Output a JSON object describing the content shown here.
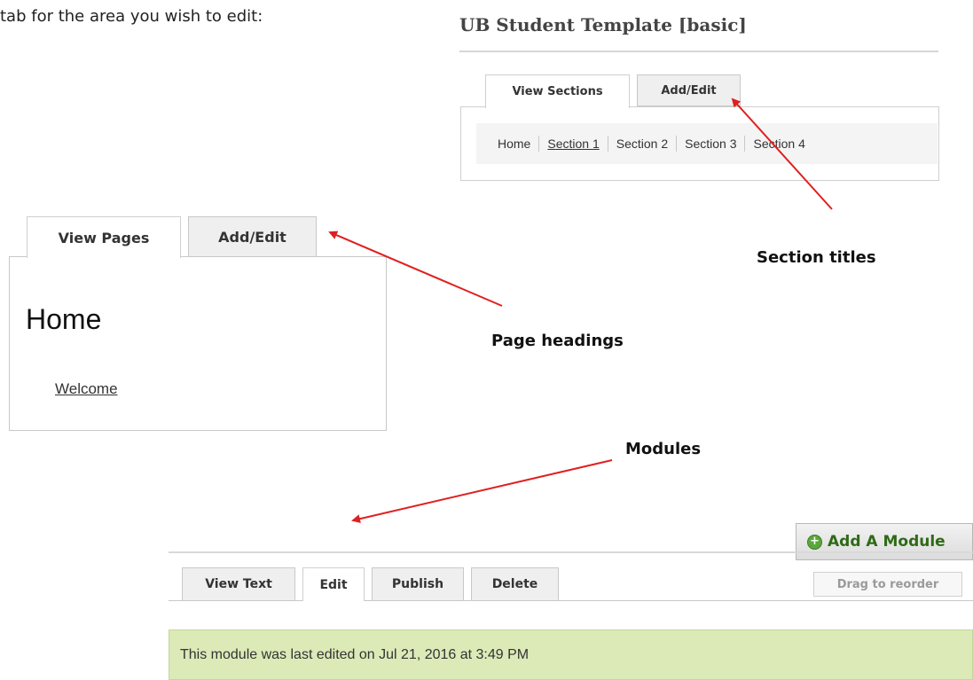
{
  "intro_text": "tab for the area you wish to edit:",
  "template": {
    "title": "UB Student Template [basic]",
    "tabs": [
      "View Sections",
      "Add/Edit"
    ],
    "sections": [
      "Home",
      "Section 1",
      "Section 2",
      "Section 3",
      "Section 4"
    ]
  },
  "pages": {
    "tabs": [
      "View Pages",
      "Add/Edit"
    ],
    "heading": "Home",
    "link": "Welcome"
  },
  "annotations": {
    "sections": "Section titles",
    "pages": "Page headings",
    "modules": "Modules"
  },
  "module": {
    "add_button": "Add A Module",
    "tabs": [
      "View Text",
      "Edit",
      "Publish",
      "Delete"
    ],
    "drag_label": "Drag to reorder",
    "notice": "This module was last edited on Jul 21, 2016 at 3:49 PM"
  },
  "colors": {
    "arrow": "#e02020",
    "notice_bg": "#dbeab7",
    "add_text": "#2e6a16"
  },
  "icons": {
    "add_module": "plus-circle-icon"
  }
}
